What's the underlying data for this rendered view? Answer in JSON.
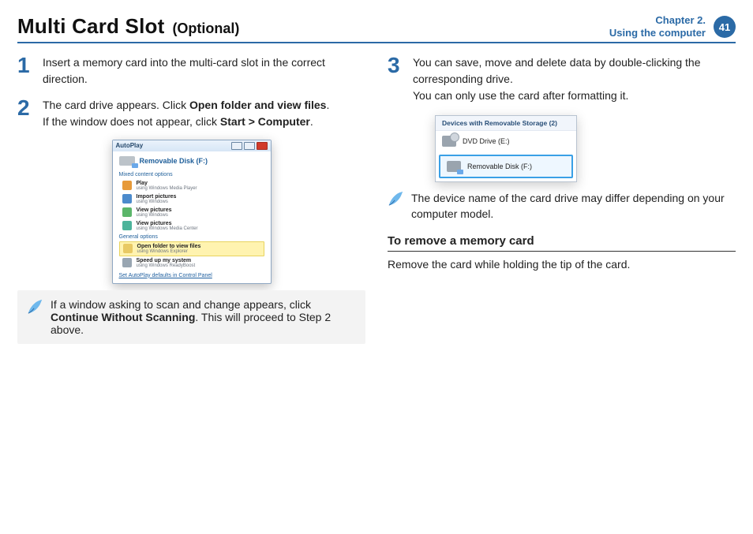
{
  "header": {
    "title": "Multi Card Slot",
    "subtitle": "(Optional)",
    "chapter_line1": "Chapter 2.",
    "chapter_line2": "Using the computer",
    "page_number": "41"
  },
  "left": {
    "step1": {
      "num": "1",
      "text": "Insert a memory card into the multi-card slot in the correct direction."
    },
    "step2": {
      "num": "2",
      "line1_a": "The card drive appears. Click ",
      "line1_b": "Open folder and view files",
      "line1_c": ".",
      "line2_a": "If the window does not appear, click ",
      "line2_b": "Start > Computer",
      "line2_c": "."
    },
    "autoplay": {
      "titlebar": "AutoPlay",
      "drive_name": "Removable Disk (F:)",
      "mixed_header": "Mixed content options",
      "general_header": "General options",
      "rows": [
        {
          "l1": "Play",
          "l2": "using Windows Media Player"
        },
        {
          "l1": "Import pictures",
          "l2": "using Windows"
        },
        {
          "l1": "View pictures",
          "l2": "using Windows"
        },
        {
          "l1": "View pictures",
          "l2": "using Windows Media Center"
        }
      ],
      "general": [
        {
          "l1": "Open folder to view files",
          "l2": "using Windows Explorer"
        },
        {
          "l1": "Speed up my system",
          "l2": "using Windows ReadyBoost"
        }
      ],
      "footer": "Set AutoPlay defaults in Control Panel"
    },
    "note": {
      "a": "If a window asking to scan and change appears, click ",
      "b": "Continue Without Scanning",
      "c": ". This will proceed to Step 2 above."
    }
  },
  "right": {
    "step3": {
      "num": "3",
      "line1": "You can save, move and delete data by double-clicking the corresponding drive.",
      "line2": "You can only use the card after formatting it."
    },
    "devices": {
      "header": "Devices with Removable Storage (2)",
      "dvd": "DVD Drive (E:)",
      "removable": "Removable Disk (F:)"
    },
    "note": "The device name of the card drive may differ depending on your computer model.",
    "section_heading": "To remove a memory card",
    "remove_text": "Remove the card while holding the tip of the card."
  }
}
